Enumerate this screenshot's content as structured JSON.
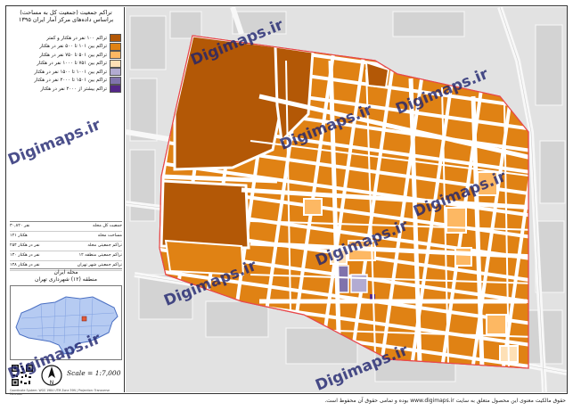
{
  "title_lines": [
    "تراکم جمعیت (جمعیت کل به مساحت)",
    "براساس داده‌های مرکز آمار ایران ۱۳۹۵"
  ],
  "legend": [
    {
      "label": "تراکم ۱۰۰ نفر در هکتار و کمتر",
      "color": "#b35806"
    },
    {
      "label": "تراکم بین ۱۰۱ تا ۵۰۰ نفر در هکتار",
      "color": "#e08214"
    },
    {
      "label": "تراکم بین ۵۰۱ تا ۷۵۰ نفر در هکتار",
      "color": "#fdb863"
    },
    {
      "label": "تراکم بین ۷۵۱ تا ۱۰۰۰ نفر در هکتار",
      "color": "#fee0b6"
    },
    {
      "label": "تراکم بین ۱۰۰۱ تا ۱۵۰۰ نفر در هکتار",
      "color": "#b2abd2"
    },
    {
      "label": "تراکم بین ۱۵۰۱ تا ۲۰۰۰ نفر در هکتار",
      "color": "#8073ac"
    },
    {
      "label": "تراکم بیشتر از ۲۰۰۰ نفر در هکتار",
      "color": "#542788"
    }
  ],
  "stats": [
    {
      "label": "جمعیت کل محله",
      "value": "۳۰,۸۲۰ نفر"
    },
    {
      "label": "مساحت محله",
      "value": "۱۲۱ هکتار"
    },
    {
      "label": "تراکم جمعیتی محله",
      "value": "۲۵۴ نفر در هکتار"
    },
    {
      "label": "تراکم جمعیتی منطقه ۱۲",
      "value": "۱۳۰ نفر در هکتار"
    },
    {
      "label": "تراکم جمعیتی شهر تهران",
      "value": "۱۴۸ نفر در هکتار"
    }
  ],
  "area_name": {
    "line1": "محله ایران",
    "line2": "منطقه (۱۲) شهرداری تهران"
  },
  "scale_text": "Scale = 1:7,000",
  "tiny_text": "Coordinate System: WGS 1984 UTM Zone 39N | Projection: Transverse Mercator",
  "watermark": "Digimaps.ir",
  "copyright": "حقوق مالکیت معنوی این محصول متعلق به سایت www.digimaps.ir بوده و تمامی حقوق آن محفوظ است.",
  "colors": {
    "density_1": "#b35806",
    "density_2": "#e08214",
    "density_3": "#fdb863",
    "density_4": "#fee0b6",
    "density_5": "#8073ac",
    "boundary": "#e8484a",
    "streets": "#ffffff",
    "background": "#e2e2e2"
  }
}
